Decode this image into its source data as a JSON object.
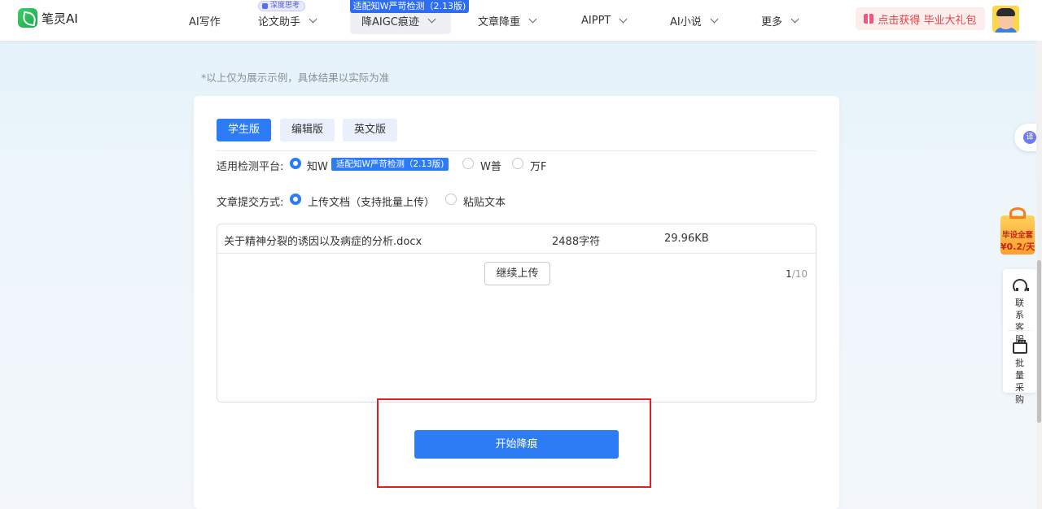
{
  "header": {
    "logo_text": "笔灵AI",
    "nav": [
      {
        "label": "AI写作"
      },
      {
        "label": "论文助手",
        "badge": "深度思考"
      },
      {
        "label": "降AIGC痕迹",
        "badge": "适配知W严苛检测（2.13版)"
      },
      {
        "label": "文章降重"
      },
      {
        "label": "AIPPT"
      },
      {
        "label": "AI小说"
      },
      {
        "label": "更多"
      }
    ],
    "promo": "点击获得 毕业大礼包"
  },
  "note": "*以上仅为展示示例，具体结果以实际为准",
  "tabs": [
    {
      "label": "学生版",
      "active": true
    },
    {
      "label": "编辑版",
      "active": false
    },
    {
      "label": "英文版",
      "active": false
    }
  ],
  "platform": {
    "label": "适用检测平台:",
    "options": [
      {
        "label": "知W",
        "selected": true,
        "tag": "适配知W严苛检测（2.13版)"
      },
      {
        "label": "W普",
        "selected": false
      },
      {
        "label": "万F",
        "selected": false
      }
    ]
  },
  "submit_mode": {
    "label": "文章提交方式:",
    "options": [
      {
        "label": "上传文档（支持批量上传）",
        "selected": true
      },
      {
        "label": "粘贴文本",
        "selected": false
      }
    ]
  },
  "files": [
    {
      "name": "关于精神分裂的诱因以及病症的分析.docx",
      "chars": "2488字符",
      "size": "29.96KB"
    }
  ],
  "continue_upload": "继续上传",
  "page_count": {
    "current": "1",
    "total": "/10"
  },
  "start_button": "开始降痕",
  "side": {
    "translate": "译",
    "gift_line1": "毕设全套",
    "gift_line2": "¥0.2/天",
    "service": "联系客服",
    "bulk": "批量采购"
  },
  "colors": {
    "accent": "#2d7cf6",
    "promo_text": "#e34242",
    "highlight": "#e02020"
  }
}
